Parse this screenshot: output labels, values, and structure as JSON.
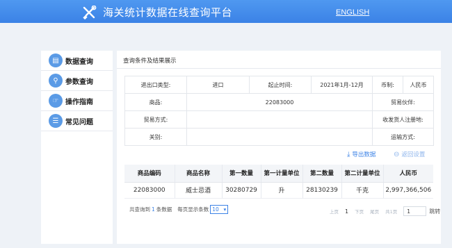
{
  "header": {
    "title": "海关统计数据在线查询平台",
    "english_link": "ENGLISH",
    "colors": {
      "bar": "#3f88ea",
      "text": "#ffffff"
    }
  },
  "sidebar": {
    "items": [
      {
        "label": "数据查询",
        "icon": "data-search-icon"
      },
      {
        "label": "参数查询",
        "icon": "param-search-icon"
      },
      {
        "label": "操作指南",
        "icon": "hand-icon"
      },
      {
        "label": "常见问题",
        "icon": "list-icon"
      }
    ]
  },
  "main": {
    "title": "查询条件及结果展示",
    "query": {
      "trade_type_label": "进出口类型:",
      "trade_type_value": "进口",
      "period_label": "起止时间:",
      "period_value": "2021年1月-12月",
      "currency_label": "币制:",
      "currency_value": "人民币",
      "commodity_label": "商品:",
      "commodity_value": "22083000",
      "partner_label": "贸易伙伴:",
      "partner_value": "",
      "trade_mode_label": "贸易方式:",
      "trade_mode_value": "",
      "consignee_label": "收发货人注册地:",
      "consignee_value": "",
      "customs_label": "关别:",
      "customs_value": "",
      "transport_label": "运输方式:",
      "transport_value": ""
    },
    "actions": {
      "export": "导出数据",
      "reset": "返回设置"
    },
    "results": {
      "columns": [
        "商品编码",
        "商品名称",
        "第一数量",
        "第一计量单位",
        "第二数量",
        "第二计量单位",
        "人民币"
      ],
      "rows": [
        [
          "22083000",
          "威士忌酒",
          "30280729",
          "升",
          "28130239",
          "千克",
          "2,997,366,506"
        ]
      ]
    },
    "footer": {
      "total_prefix": "共查询到",
      "total_count": "1",
      "total_suffix": "条数据",
      "per_page_label": "每页显示条数",
      "per_page_value": "10"
    },
    "pager": {
      "prev": "上页",
      "current": "1",
      "next": "下页",
      "last": "尾页",
      "total": "共1页",
      "input_value": "1",
      "go": "跳转"
    }
  }
}
